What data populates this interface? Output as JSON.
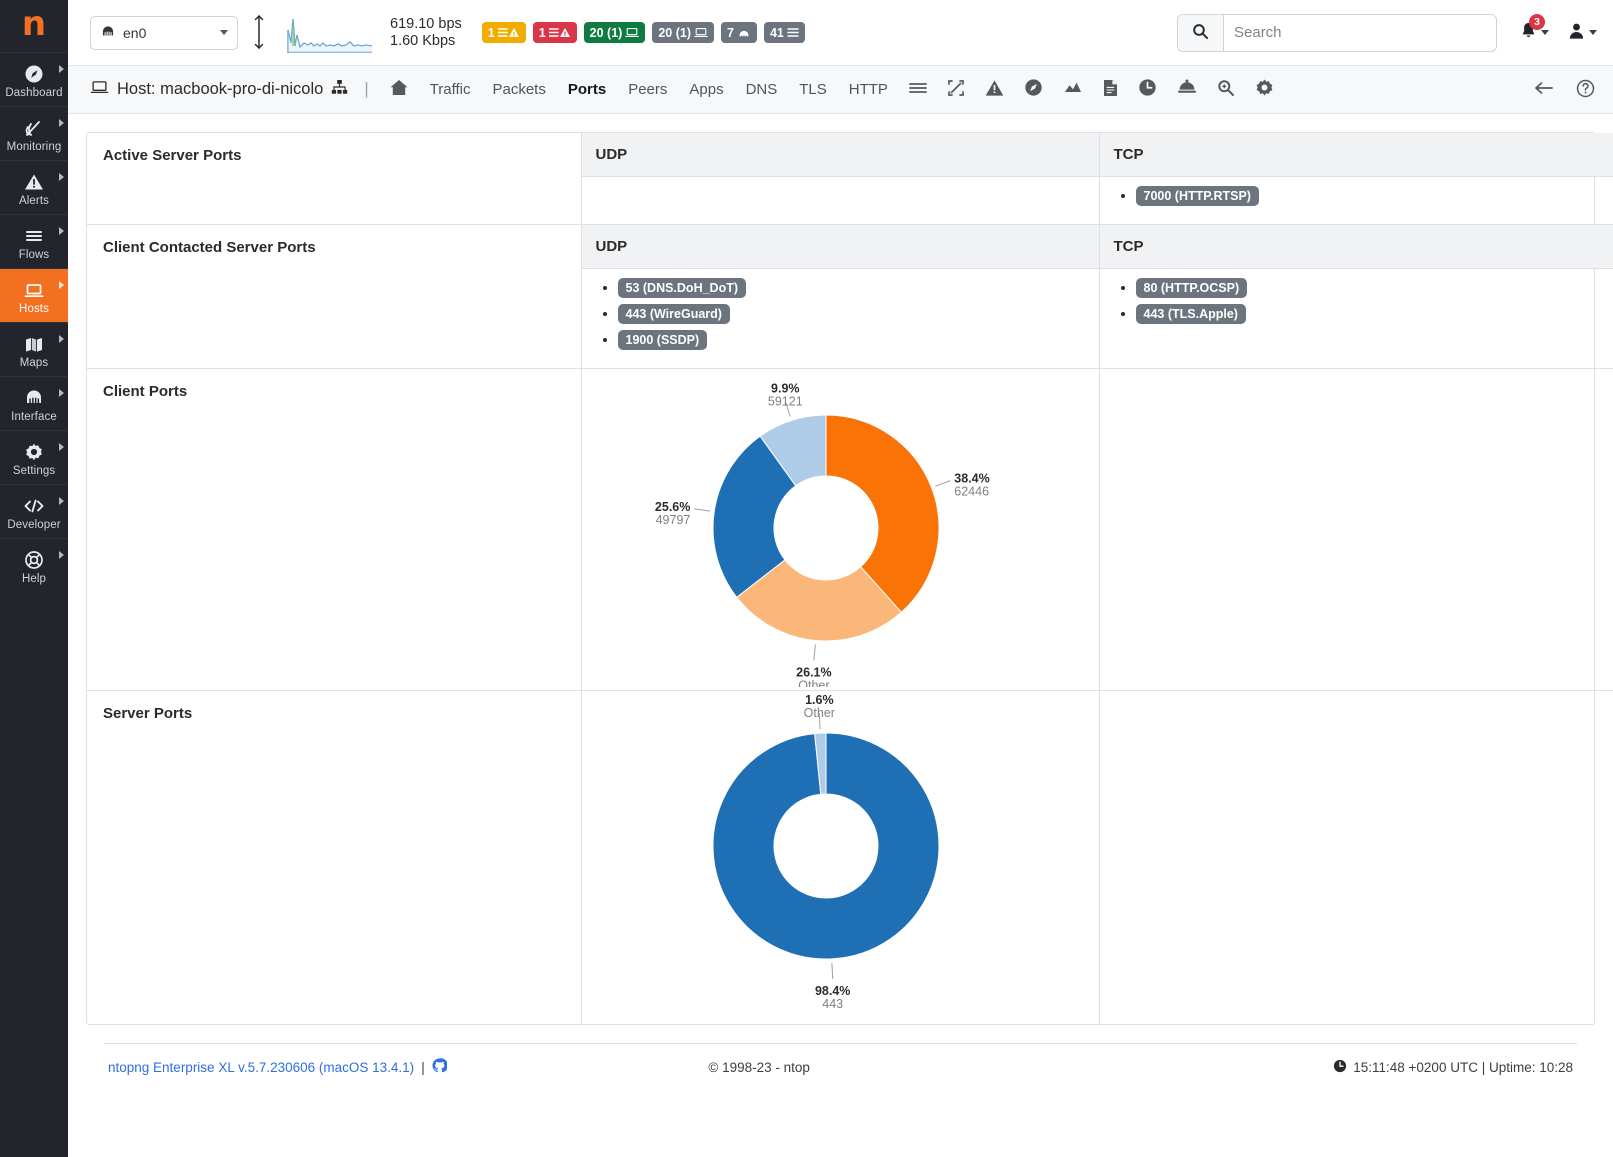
{
  "brand": {
    "logo_glyph": "n",
    "accent": "#f37021"
  },
  "sidebar": {
    "items": [
      {
        "label": "Dashboard",
        "icon": "dashboard-gauge-icon",
        "active": false
      },
      {
        "label": "Monitoring",
        "icon": "radar-icon",
        "active": false
      },
      {
        "label": "Alerts",
        "icon": "warning-triangle-icon",
        "active": false
      },
      {
        "label": "Flows",
        "icon": "list-lines-icon",
        "active": false
      },
      {
        "label": "Hosts",
        "icon": "laptop-icon",
        "active": true
      },
      {
        "label": "Maps",
        "icon": "map-icon",
        "active": false
      },
      {
        "label": "Interface",
        "icon": "ethernet-port-icon",
        "active": false
      },
      {
        "label": "Settings",
        "icon": "gear-icon",
        "active": false
      },
      {
        "label": "Developer",
        "icon": "code-brackets-icon",
        "active": false
      },
      {
        "label": "Help",
        "icon": "lifebuoy-icon",
        "active": false
      }
    ]
  },
  "topbar": {
    "interface_selected": "en0",
    "interface_icon": "ethernet-port-icon",
    "throughput_down": "619.10 bps",
    "throughput_up": "1.60 Kbps",
    "badges": [
      {
        "text": "1",
        "icon": "list-warning-icon",
        "color": "#f0ad00",
        "name": "engaged-alerts-badge"
      },
      {
        "text": "1",
        "icon": "list-warning-icon",
        "color": "#d9364a",
        "name": "flow-alerts-badge"
      },
      {
        "text": "20 (1)",
        "icon": "laptop-icon",
        "color": "#0f7b41",
        "name": "local-hosts-badge"
      },
      {
        "text": "20 (1)",
        "icon": "laptop-icon",
        "color": "#6c757d",
        "name": "remote-hosts-badge"
      },
      {
        "text": "7",
        "icon": "devices-icon",
        "color": "#6c757d",
        "name": "devices-badge"
      },
      {
        "text": "41",
        "icon": "list-lines-icon",
        "color": "#6c757d",
        "name": "flows-badge"
      }
    ],
    "search_placeholder": "Search",
    "search_value": "",
    "notification_count": "3"
  },
  "pagenav": {
    "host_label": "Host: macbook-pro-di-nicolo",
    "host_icon": "laptop-icon",
    "sitemap_icon": "sitemap-icon",
    "separator": "|",
    "tabs": [
      {
        "label": "",
        "icon": "home-icon",
        "active": false,
        "name": "tab-home"
      },
      {
        "label": "Traffic",
        "icon": "",
        "active": false,
        "name": "tab-traffic"
      },
      {
        "label": "Packets",
        "icon": "",
        "active": false,
        "name": "tab-packets"
      },
      {
        "label": "Ports",
        "icon": "",
        "active": true,
        "name": "tab-ports"
      },
      {
        "label": "Peers",
        "icon": "",
        "active": false,
        "name": "tab-peers"
      },
      {
        "label": "Apps",
        "icon": "",
        "active": false,
        "name": "tab-apps"
      },
      {
        "label": "DNS",
        "icon": "",
        "active": false,
        "name": "tab-dns"
      },
      {
        "label": "TLS",
        "icon": "",
        "active": false,
        "name": "tab-tls"
      },
      {
        "label": "HTTP",
        "icon": "",
        "active": false,
        "name": "tab-http"
      },
      {
        "label": "",
        "icon": "list-lines-icon",
        "active": false,
        "name": "tab-flows"
      },
      {
        "label": "",
        "icon": "snmp-icon",
        "active": false,
        "name": "tab-snmp"
      },
      {
        "label": "",
        "icon": "warning-triangle-icon",
        "active": false,
        "name": "tab-alerts"
      },
      {
        "label": "",
        "icon": "compass-icon",
        "active": false,
        "name": "tab-traffic-map"
      },
      {
        "label": "",
        "icon": "chart-area-icon",
        "active": false,
        "name": "tab-charts"
      },
      {
        "label": "",
        "icon": "file-report-icon",
        "active": false,
        "name": "tab-report"
      },
      {
        "label": "",
        "icon": "clock-icon",
        "active": false,
        "name": "tab-historical"
      },
      {
        "label": "",
        "icon": "service-bell-icon",
        "active": false,
        "name": "tab-services"
      },
      {
        "label": "",
        "icon": "search-plus-icon",
        "active": false,
        "name": "tab-search"
      },
      {
        "label": "",
        "icon": "gear-icon",
        "active": false,
        "name": "tab-config"
      }
    ],
    "back_icon": "arrow-left-icon",
    "help_icon": "question-circle-icon"
  },
  "sections": {
    "active_server_ports": {
      "title": "Active Server Ports",
      "udp": {
        "header": "UDP",
        "ports": []
      },
      "tcp": {
        "header": "TCP",
        "ports": [
          "7000 (HTTP.RTSP)"
        ]
      }
    },
    "client_contacted_server_ports": {
      "title": "Client Contacted Server Ports",
      "udp": {
        "header": "UDP",
        "ports": [
          "53 (DNS.DoH_DoT)",
          "443 (WireGuard)",
          "1900 (SSDP)"
        ]
      },
      "tcp": {
        "header": "TCP",
        "ports": [
          "80 (HTTP.OCSP)",
          "443 (TLS.Apple)"
        ]
      }
    },
    "client_ports": {
      "title": "Client Ports"
    },
    "server_ports": {
      "title": "Server Ports"
    }
  },
  "chart_data": [
    {
      "type": "pie",
      "name": "client-ports-donut",
      "title": "Client Ports",
      "donut": true,
      "labels": [
        "62446",
        "Other",
        "49797",
        "59121"
      ],
      "values": [
        38.4,
        26.1,
        25.6,
        9.9
      ],
      "percent_labels": [
        "38.4%",
        "26.1%",
        "25.6%",
        "9.9%"
      ],
      "value_labels": [
        "62446",
        "Other",
        "49797",
        "59121"
      ],
      "colors": [
        "#f97306",
        "#fbb77a",
        "#1f6fb5",
        "#aecbe8"
      ],
      "legend": "none"
    },
    {
      "type": "pie",
      "name": "server-ports-donut",
      "title": "Server Ports",
      "donut": true,
      "labels": [
        "443",
        "Other"
      ],
      "values": [
        98.4,
        1.6
      ],
      "percent_labels": [
        "98.4%",
        "1.6%"
      ],
      "value_labels": [
        "443",
        "Other"
      ],
      "colors": [
        "#1f6fb5",
        "#aecbe8"
      ],
      "legend": "none"
    }
  ],
  "footer": {
    "version_link": "ntopng Enterprise XL v.5.7.230606 (macOS 13.4.1)",
    "github_icon": "github-icon",
    "separator": "|",
    "copyright": "© 1998-23 - ntop",
    "clock_icon": "clock-icon",
    "time": "15:11:48 +0200 UTC | Uptime: 10:28"
  }
}
